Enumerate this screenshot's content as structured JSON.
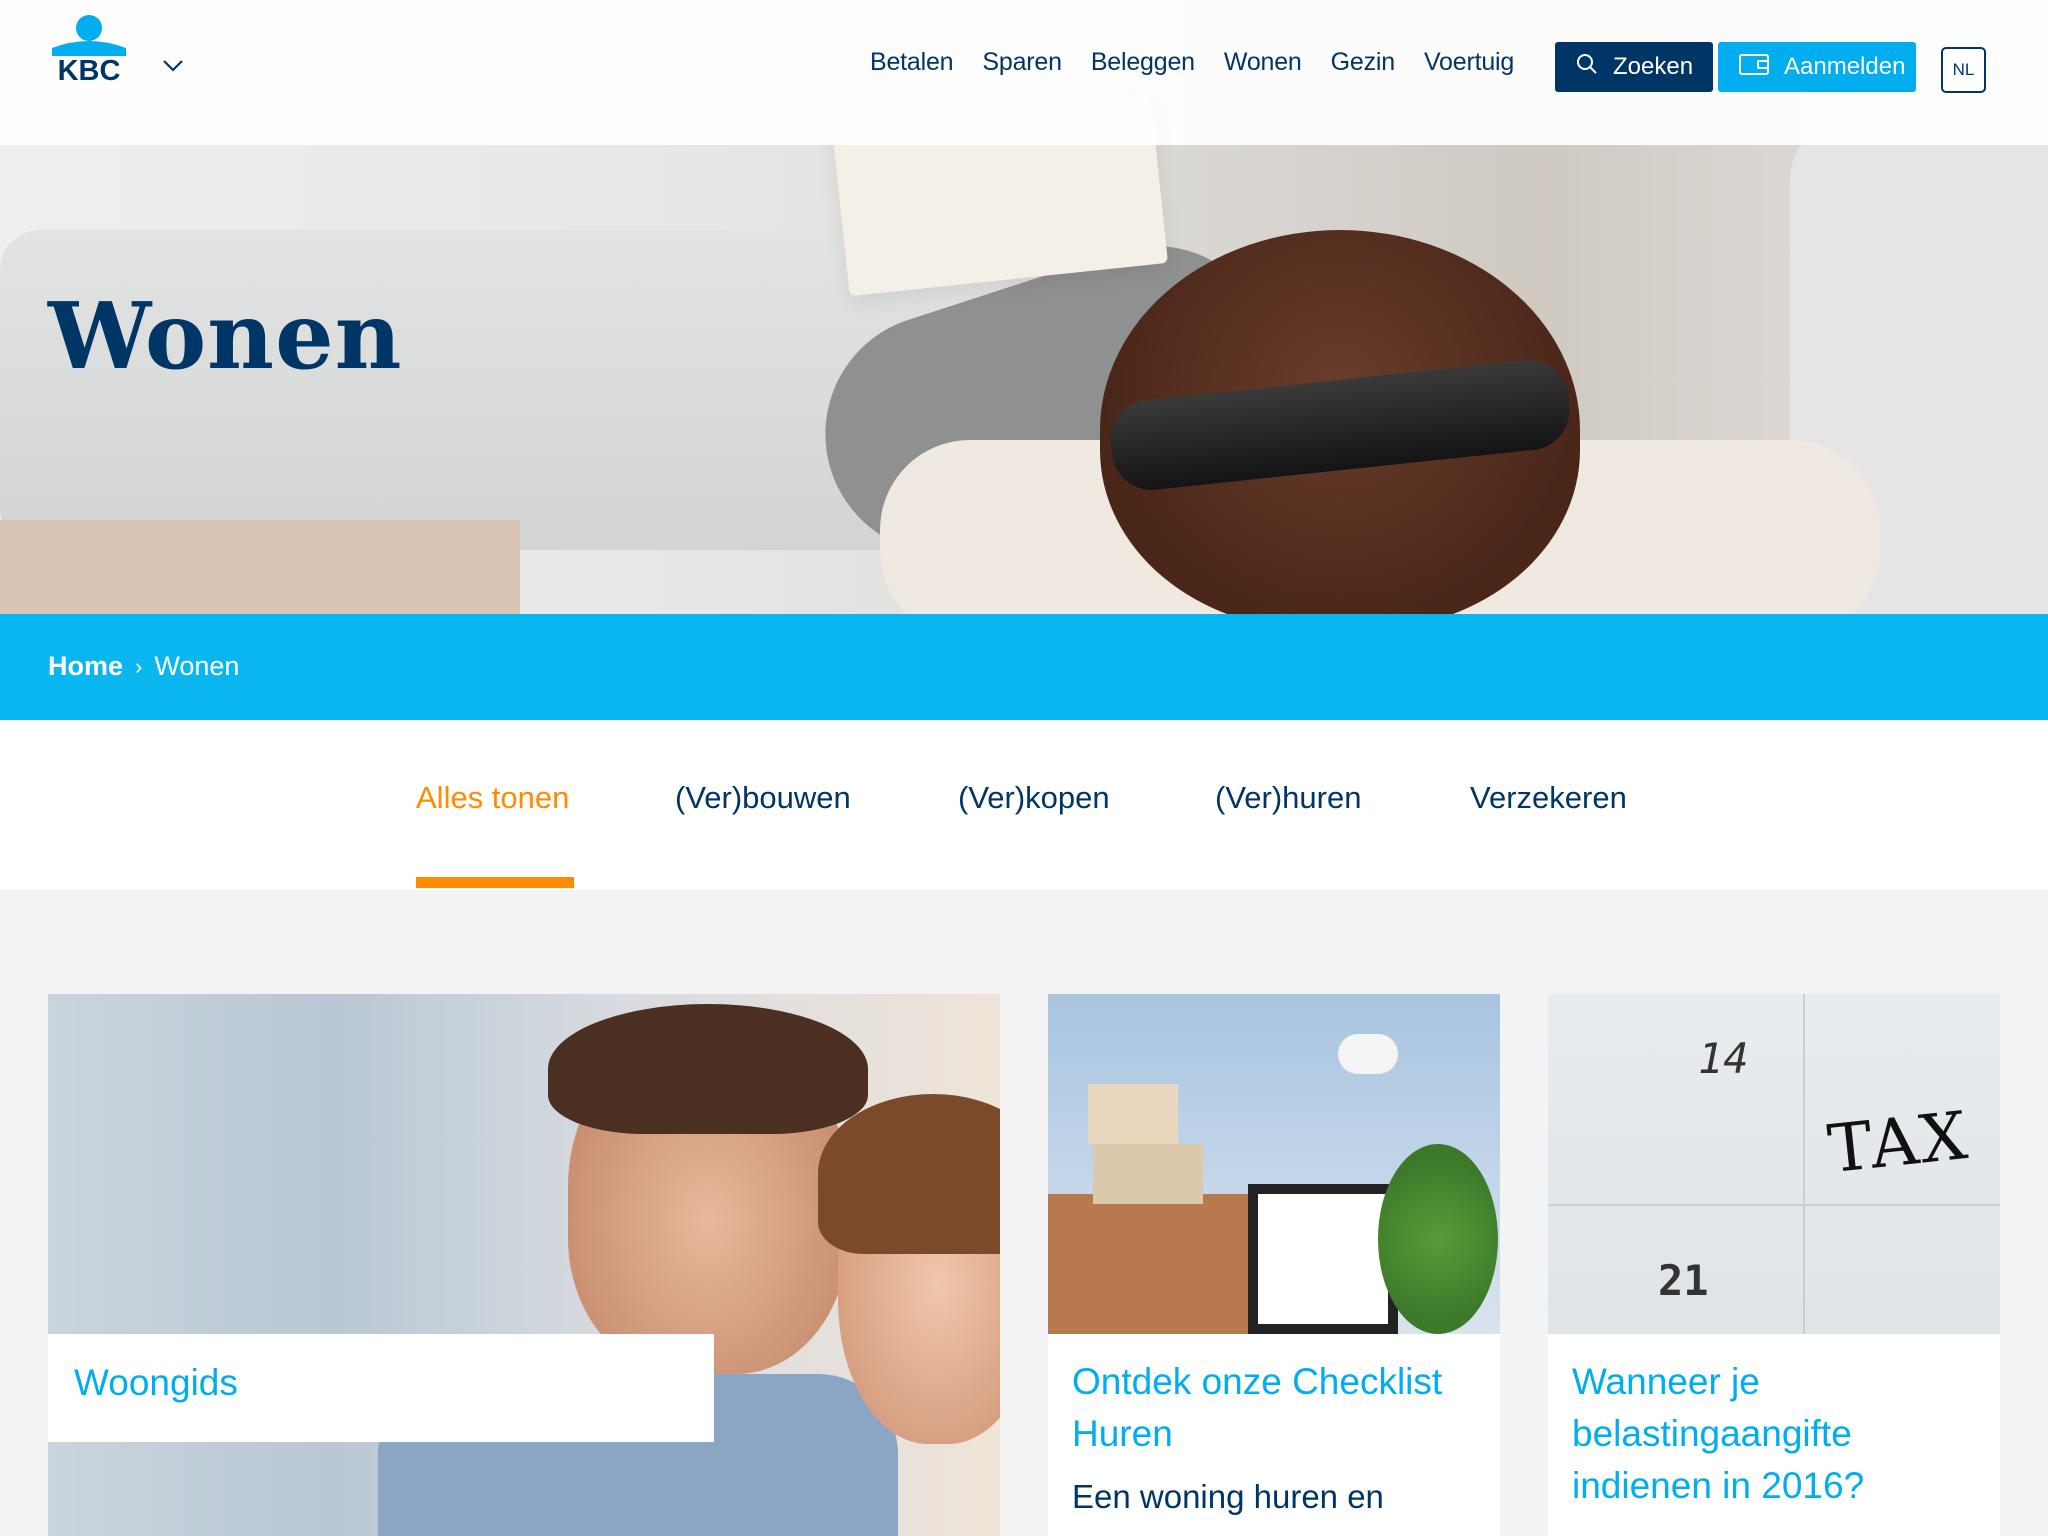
{
  "header": {
    "brand": "KBC",
    "nav": [
      "Betalen",
      "Sparen",
      "Beleggen",
      "Wonen",
      "Gezin",
      "Voertuig"
    ],
    "search_label": "Zoeken",
    "login_label": "Aanmelden",
    "language": "NL"
  },
  "hero": {
    "title": "Wonen"
  },
  "breadcrumb": {
    "home": "Home",
    "current": "Wonen"
  },
  "tabs": [
    "Alles tonen",
    "(Ver)bouwen",
    "(Ver)kopen",
    "(Ver)huren",
    "Verzekeren"
  ],
  "active_tab": "Alles tonen",
  "cards": [
    {
      "title": "Woongids"
    },
    {
      "title": "Ontdek onze Checklist Huren",
      "text": "Een woning huren en"
    },
    {
      "title": "Wanneer je belastingaangifte indienen in 2016?",
      "image_text": [
        "14",
        "TAX",
        "21"
      ]
    }
  ],
  "colors": {
    "navy": "#003665",
    "blue": "#00aeef",
    "accent": "#ff8c00",
    "bar": "#0ab6f0"
  }
}
